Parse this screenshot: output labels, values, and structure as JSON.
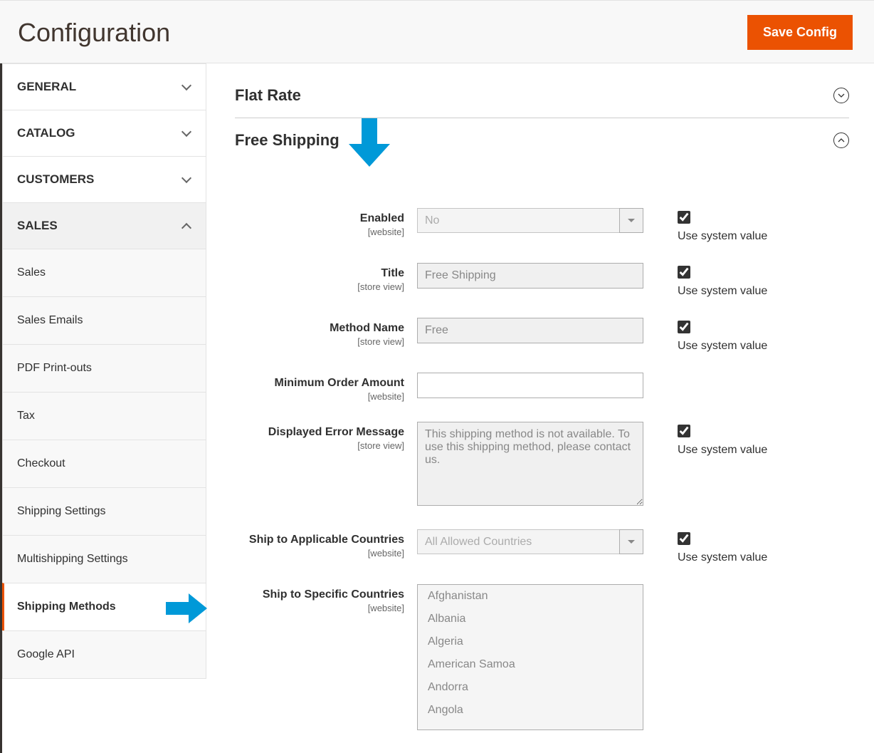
{
  "header": {
    "title": "Configuration",
    "save_button": "Save Config"
  },
  "sidebar": {
    "groups": [
      {
        "label": "GENERAL",
        "expanded": false
      },
      {
        "label": "CATALOG",
        "expanded": false
      },
      {
        "label": "CUSTOMERS",
        "expanded": false
      },
      {
        "label": "SALES",
        "expanded": true
      }
    ],
    "sales_items": [
      {
        "label": "Sales",
        "active": false
      },
      {
        "label": "Sales Emails",
        "active": false
      },
      {
        "label": "PDF Print-outs",
        "active": false
      },
      {
        "label": "Tax",
        "active": false
      },
      {
        "label": "Checkout",
        "active": false
      },
      {
        "label": "Shipping Settings",
        "active": false
      },
      {
        "label": "Multishipping Settings",
        "active": false
      },
      {
        "label": "Shipping Methods",
        "active": true
      },
      {
        "label": "Google API",
        "active": false
      }
    ]
  },
  "sections": {
    "flat_rate": {
      "title": "Flat Rate"
    },
    "free_shipping": {
      "title": "Free Shipping"
    }
  },
  "fields": {
    "enabled": {
      "label": "Enabled",
      "scope": "[website]",
      "value": "No"
    },
    "title": {
      "label": "Title",
      "scope": "[store view]",
      "value": "Free Shipping"
    },
    "method_name": {
      "label": "Method Name",
      "scope": "[store view]",
      "value": "Free"
    },
    "min_order": {
      "label": "Minimum Order Amount",
      "scope": "[website]",
      "value": ""
    },
    "error_msg": {
      "label": "Displayed Error Message",
      "scope": "[store view]",
      "value": "This shipping method is not available. To use this shipping method, please contact us."
    },
    "applicable": {
      "label": "Ship to Applicable Countries",
      "scope": "[website]",
      "value": "All Allowed Countries"
    },
    "specific": {
      "label": "Ship to Specific Countries",
      "scope": "[website]"
    }
  },
  "use_system": "Use system value",
  "countries": [
    "Afghanistan",
    "Albania",
    "Algeria",
    "American Samoa",
    "Andorra",
    "Angola"
  ]
}
